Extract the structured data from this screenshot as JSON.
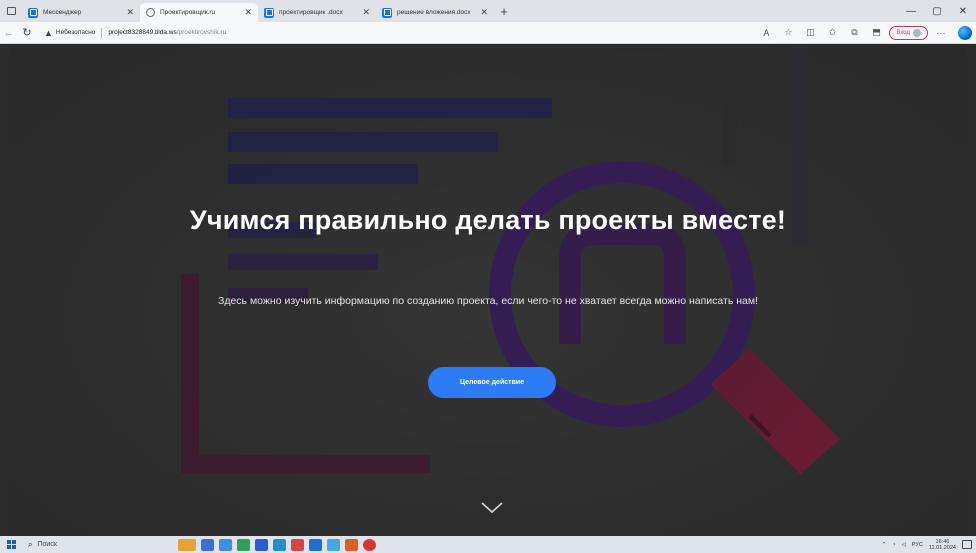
{
  "browser": {
    "tabs": [
      {
        "label": "Мессенджер",
        "favicon": "blue-square-icon",
        "active": false
      },
      {
        "label": "Проектировщик.ru",
        "favicon": "globe-icon",
        "active": true
      },
      {
        "label": "проектировщик .docx",
        "favicon": "blue-square-icon",
        "active": false
      },
      {
        "label": "решение вложения.docx",
        "favicon": "blue-square-icon",
        "active": false
      }
    ],
    "new_tab_symbol": "+",
    "security_label": "Небезопасно",
    "url_host": "project8328849.tilda.ws",
    "url_path": "/proektirovshik.ru",
    "profile_label": "Вход"
  },
  "hero": {
    "title": "Учимся правильно делать проекты вместе!",
    "description": "Здесь можно изучить информацию по созданию проекта, если чего-то не хватает всегда можно написать нам!",
    "cta_label": "Целевое действие"
  },
  "taskbar": {
    "search_placeholder": "Поиск",
    "language": "РУС",
    "time": "16:46",
    "date": "11.01.2024"
  },
  "colors": {
    "accent_button": "#2d7cf6",
    "art_magenta": "#c0186a",
    "art_purple": "#3a1570",
    "art_navy": "#1b1f6e"
  }
}
